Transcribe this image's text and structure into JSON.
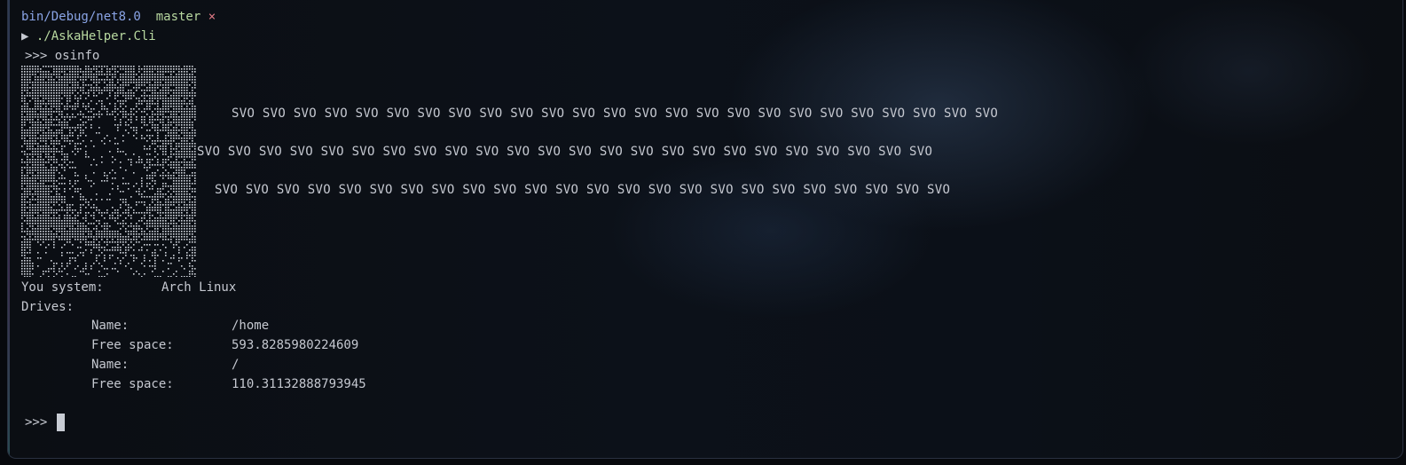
{
  "prompt_header": {
    "path": "bin/Debug/net8.0",
    "branch": "master",
    "dirty_mark": "×"
  },
  "command_line": {
    "arrow": "▶",
    "command": "./AskaHelper.Cli"
  },
  "repl": {
    "prompt": ">>>",
    "input": "osinfo"
  },
  "ascii_art": {
    "icon": "ascii-portrait-art"
  },
  "svo_rows": [
    "SVO SVO SVO SVO SVO SVO SVO SVO SVO SVO SVO SVO SVO SVO SVO SVO SVO SVO SVO SVO SVO SVO SVO SVO SVO",
    "SVO SVO SVO SVO SVO SVO SVO SVO SVO SVO SVO SVO SVO SVO SVO SVO SVO SVO SVO SVO SVO SVO SVO SVO",
    "SVO SVO SVO SVO SVO SVO SVO SVO SVO SVO SVO SVO SVO SVO SVO SVO SVO SVO SVO SVO SVO SVO SVO SVO"
  ],
  "system": {
    "label": "You system:",
    "value": "Arch Linux"
  },
  "drives": {
    "label": "Drives:",
    "items": [
      {
        "name_label": "Name:",
        "name": "/home",
        "free_label": "Free space:",
        "free": "593.8285980224609"
      },
      {
        "name_label": "Name:",
        "name": "/",
        "free_label": "Free space:",
        "free": "110.31132888793945"
      }
    ]
  },
  "final_prompt": ">>>",
  "colors": {
    "path": "#8aa4e6",
    "branch": "#b8d8a0",
    "dirty": "#e07a86",
    "text": "#c5c8d0"
  }
}
